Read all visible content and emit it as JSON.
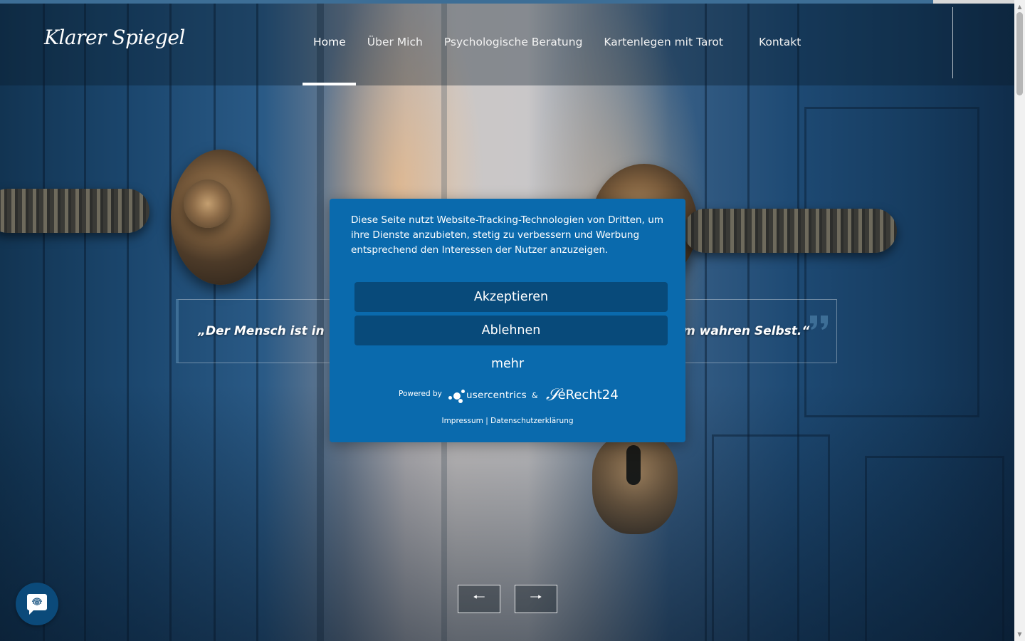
{
  "page_progress": 0.92,
  "colors": {
    "accent": "#3d6e96",
    "consent_background": "#0a6aad",
    "consent_button": "#084a7a"
  },
  "header": {
    "logo_text": "Klarer Spiegel",
    "nav": [
      {
        "label": "Home",
        "active": true
      },
      {
        "label": "Über Mich"
      },
      {
        "label": "Psychologische Beratung"
      },
      {
        "label": "Kartenlegen mit Tarot"
      },
      {
        "label": "Kontakt"
      }
    ]
  },
  "hero": {
    "quote_left": "„Der Mensch ist in",
    "quote_right": "m wahren Selbst.“",
    "quote_icon": "closing-quote-icon",
    "prev_icon": "arrow-left-icon",
    "next_icon": "arrow-right-icon",
    "prev_glyph": "🠐",
    "next_glyph": "🠒"
  },
  "consent": {
    "text": "Diese Seite nutzt Website-Tracking-Technologien von Dritten, um ihre Dienste anzubieten, stetig zu verbessern und Werbung entsprechend den Interessen der Nutzer anzuzeigen.",
    "accept_label": "Akzeptieren",
    "decline_label": "Ablehnen",
    "more_label": "mehr",
    "powered_by": "Powered by",
    "usercentrics": "usercentrics",
    "ampersand": "&",
    "erecht24": "eRecht24",
    "impressum": "Impressum",
    "separator": "|",
    "datenschutz": "Datenschutzerklärung"
  },
  "chat": {
    "icon": "fingerprint-chat-icon"
  }
}
